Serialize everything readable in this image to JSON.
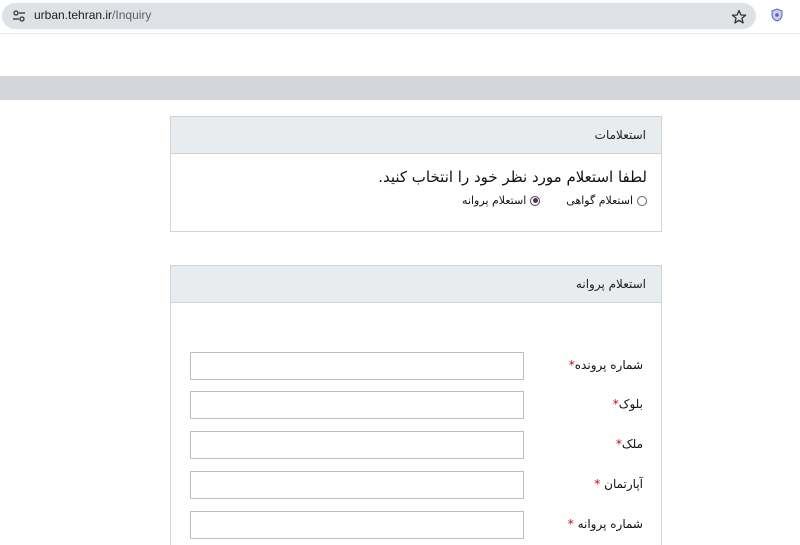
{
  "browser": {
    "url_host": "urban.tehran.ir",
    "url_path": "/Inquiry"
  },
  "inquiries_panel": {
    "title": "استعلامات",
    "prompt": "لطفا استعلام مورد نظر خود را انتخاب کنید.",
    "options": [
      {
        "label": "استعلام گواهی",
        "checked": false
      },
      {
        "label": "استعلام پروانه",
        "checked": true
      }
    ]
  },
  "license_panel": {
    "title": "استعلام پروانه",
    "fields": [
      {
        "label": "شماره پرونده",
        "required_mark": "*",
        "value": ""
      },
      {
        "label": "بلوک",
        "required_mark": "*",
        "value": ""
      },
      {
        "label": "ملک",
        "required_mark": "*",
        "value": ""
      },
      {
        "label": "آپارتمان",
        "required_mark": "*",
        "value": ""
      },
      {
        "label": "شماره پروانه",
        "required_mark": "*",
        "value": ""
      }
    ]
  },
  "colors": {
    "accent_radio": "#5a2a55",
    "required": "#d0021b",
    "panel_header": "#e9ecef"
  }
}
